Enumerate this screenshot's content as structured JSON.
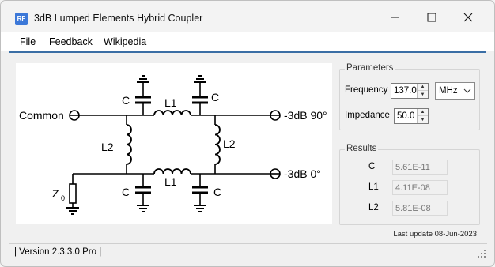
{
  "window": {
    "title": "3dB Lumped Elements Hybrid Coupler",
    "icon_text": "RF",
    "controls": [
      "minimize-icon",
      "maximize-icon",
      "close-icon"
    ]
  },
  "menu": {
    "items": [
      "File",
      "Feedback",
      "Wikipedia"
    ]
  },
  "diagram": {
    "common": "Common",
    "port_90": "-3dB 90°",
    "port_0": "-3dB 0°",
    "c": "C",
    "l1": "L1",
    "l2": "L2",
    "z0": "Z",
    "z0_sub": "0"
  },
  "parameters": {
    "title": "Parameters",
    "frequency_label": "Frequency",
    "frequency_value": "137.0",
    "unit": "MHz",
    "impedance_label": "Impedance",
    "impedance_value": "50.0"
  },
  "results": {
    "title": "Results",
    "rows": [
      {
        "label": "C",
        "value": "5.61E-11"
      },
      {
        "label": "L1",
        "value": "4.11E-08"
      },
      {
        "label": "L2",
        "value": "5.81E-08"
      }
    ]
  },
  "footer": {
    "last_update": "Last update 08-Jun-2023",
    "status": "| Version 2.3.3.0 Pro |"
  },
  "colors": {
    "accent": "#3a6ea5",
    "icon_bg": "#3c78d8"
  }
}
